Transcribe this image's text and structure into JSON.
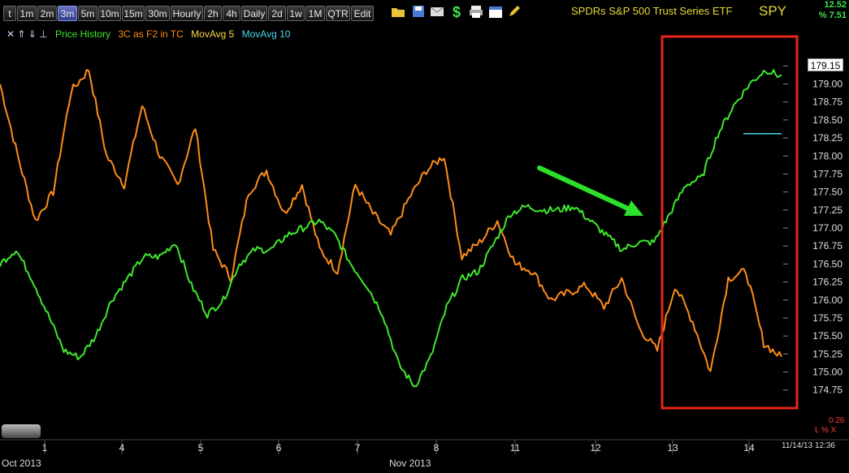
{
  "toolbar": {
    "timeframes": [
      "t",
      "1m",
      "2m",
      "3m",
      "5m",
      "10m",
      "15m",
      "30m",
      "Hourly",
      "2h",
      "4h",
      "Daily",
      "2d",
      "1w",
      "1M",
      "QTR",
      "Edit"
    ],
    "active": "3m",
    "icons": [
      "folder-icon",
      "save-icon",
      "mail-icon",
      "dollar-icon",
      "print-icon",
      "calendar-icon",
      "pencil-icon"
    ]
  },
  "symbol": {
    "name": "SPDRs S&P 500 Trust Series ETF",
    "ticker": "SPY",
    "change": "12.52",
    "change_pct": "% 7.51",
    "last_price": "179.15"
  },
  "legend": {
    "arrows": "✕ ⇑ ⇓ ⊥",
    "price_history": "Price History",
    "indicator": "3C as F2 in TC",
    "mavg5": "MovAvg 5",
    "mavg10": "MovAvg 10"
  },
  "colors": {
    "price": "#3ee82c",
    "indicator": "#ff8c1a",
    "mavg5": "#ffd84a",
    "mavg10": "#4ad8e8",
    "highlight": "#e8241a",
    "arrow": "#2de02a"
  },
  "bottom": {
    "month_left": "Oct 2013",
    "month_mid": "Nov 2013",
    "timestamp": "11/14/13 12:36",
    "lower_value": "0.26",
    "lower_label": "L % X"
  },
  "chart_data": {
    "type": "line",
    "x_tick_labels": [
      "1",
      "4",
      "5",
      "6",
      "7",
      "8",
      "11",
      "12",
      "13",
      "14"
    ],
    "y_ticks": [
      174.75,
      175.0,
      175.25,
      175.5,
      175.75,
      176.0,
      176.25,
      176.5,
      176.75,
      177.0,
      177.25,
      177.5,
      177.75,
      178.0,
      178.25,
      178.5,
      178.75,
      179.0,
      179.25
    ],
    "ylim": [
      174.6,
      179.4
    ],
    "series": [
      {
        "name": "Price History",
        "values": [
          176.5,
          176.7,
          176.3,
          175.8,
          175.3,
          175.2,
          175.5,
          176.0,
          176.3,
          176.6,
          176.6,
          176.8,
          176.2,
          175.8,
          176.0,
          176.5,
          176.7,
          176.7,
          176.9,
          177.0,
          177.1,
          176.9,
          176.5,
          176.2,
          175.8,
          175.1,
          174.8,
          175.2,
          175.9,
          176.3,
          176.4,
          176.8,
          177.2,
          177.3,
          177.25,
          177.25,
          177.3,
          177.1,
          176.9,
          176.7,
          176.8,
          176.8,
          177.2,
          177.6,
          177.7,
          178.3,
          178.7,
          179.0,
          179.2,
          179.1
        ]
      },
      {
        "name": "3C as F2 in TC",
        "values": [
          179.0,
          178.0,
          177.1,
          177.5,
          178.9,
          179.2,
          178.0,
          177.6,
          178.7,
          178.0,
          177.6,
          178.4,
          176.7,
          176.3,
          177.5,
          177.8,
          177.2,
          177.6,
          176.7,
          176.4,
          177.6,
          177.2,
          176.9,
          177.4,
          177.8,
          178.0,
          176.6,
          176.8,
          177.1,
          176.5,
          176.4,
          176.0,
          176.1,
          176.2,
          175.9,
          176.3,
          175.6,
          175.3,
          176.2,
          175.7,
          175.0,
          176.3,
          176.4,
          175.4,
          175.2
        ]
      },
      {
        "name": "MovAvg 10",
        "values": [
          178.31,
          178.31
        ]
      }
    ]
  }
}
